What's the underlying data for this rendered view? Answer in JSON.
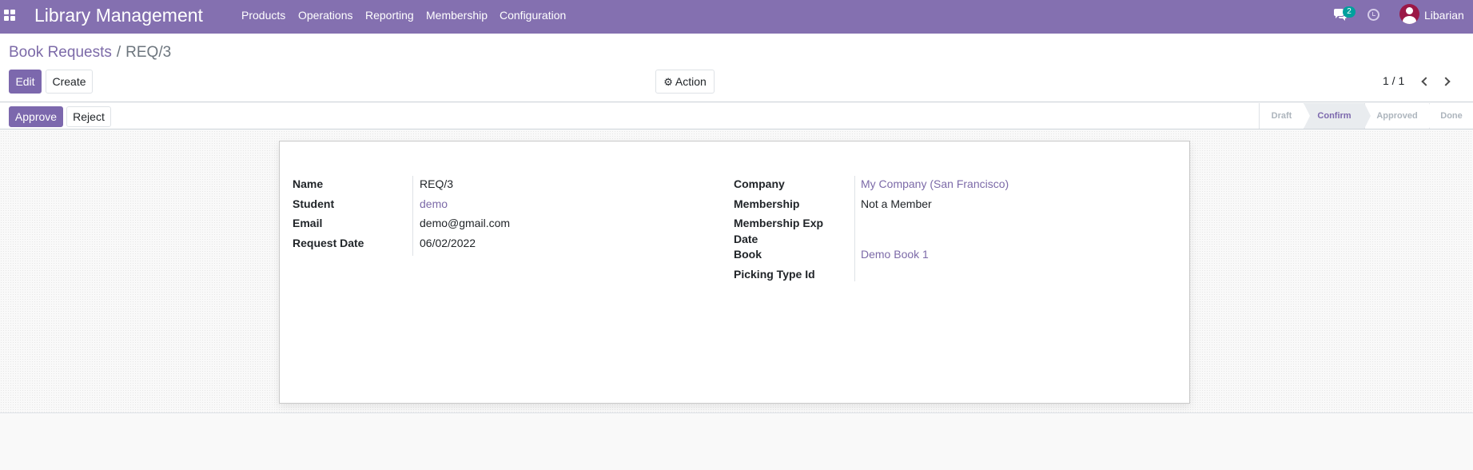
{
  "navbar": {
    "brand": "Library Management",
    "menu": [
      "Products",
      "Operations",
      "Reporting",
      "Membership",
      "Configuration"
    ],
    "chat_count": "2",
    "user": "Libarian",
    "colors": {
      "navbar": "#8470b0",
      "badge": "#00a09d",
      "avatar": "#9b1846"
    }
  },
  "breadcrumb": {
    "parent": "Book Requests",
    "separator": "/",
    "current": "REQ/3"
  },
  "control": {
    "edit_label": "Edit",
    "create_label": "Create",
    "action_label": "Action",
    "pager": "1 / 1"
  },
  "statusbar": {
    "approve_label": "Approve",
    "reject_label": "Reject",
    "stages": [
      "Draft",
      "Confirm",
      "Approved",
      "Done"
    ],
    "active_stage": "Confirm"
  },
  "form": {
    "left": [
      {
        "label": "Name",
        "value": "REQ/3",
        "link": false
      },
      {
        "label": "Student",
        "value": "demo",
        "link": true
      },
      {
        "label": "Email",
        "value": "demo@gmail.com",
        "link": false
      },
      {
        "label": "Request Date",
        "value": "06/02/2022",
        "link": false
      }
    ],
    "right": [
      {
        "label": "Company",
        "value": "My Company (San Francisco)",
        "link": true
      },
      {
        "label": "Membership",
        "value": "Not a Member",
        "link": false
      },
      {
        "label_line1": "Membership Exp",
        "label_line2": "Date",
        "value": "",
        "link": false
      },
      {
        "label": "Book",
        "value": "Demo Book 1",
        "link": true
      },
      {
        "label": "Picking Type Id",
        "value": "",
        "link": false
      }
    ]
  }
}
